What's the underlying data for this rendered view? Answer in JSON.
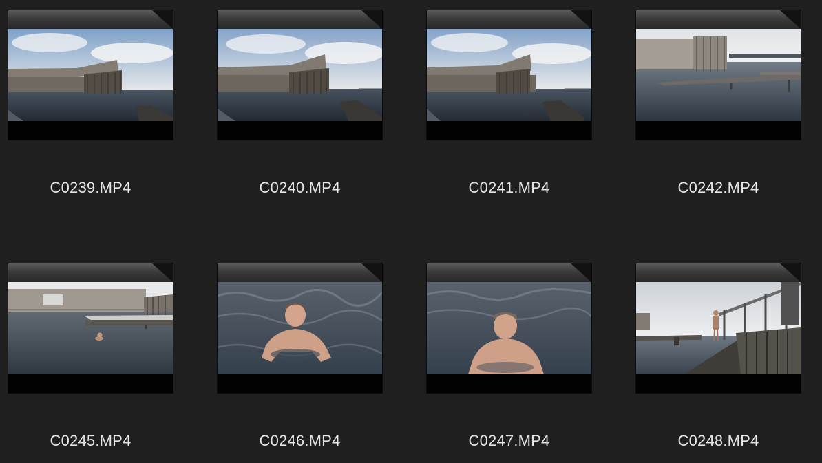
{
  "files": [
    {
      "name": "C0239.MP4",
      "scene": "sauna-platform-wide"
    },
    {
      "name": "C0240.MP4",
      "scene": "sauna-platform-wide"
    },
    {
      "name": "C0241.MP4",
      "scene": "sauna-platform-wide"
    },
    {
      "name": "C0242.MP4",
      "scene": "sauna-platform-pier"
    },
    {
      "name": "C0245.MP4",
      "scene": "swimmer-distant"
    },
    {
      "name": "C0246.MP4",
      "scene": "swimmer-closeup"
    },
    {
      "name": "C0247.MP4",
      "scene": "swimmer-closeup-low"
    },
    {
      "name": "C0248.MP4",
      "scene": "pier-walk"
    }
  ]
}
